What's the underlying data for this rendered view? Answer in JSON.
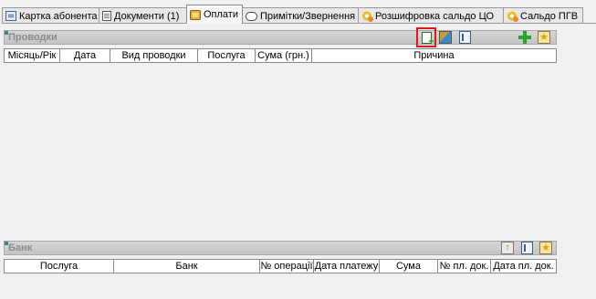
{
  "tabs": [
    {
      "label": "Картка абонента",
      "icon": "card-icon"
    },
    {
      "label": "Документи (1)",
      "icon": "document-icon"
    },
    {
      "label": "Оплати",
      "icon": "payments-icon"
    },
    {
      "label": "Примітки/Звернення",
      "icon": "note-icon"
    },
    {
      "label": "Розшифровка сальдо ЦО",
      "icon": "gear-icon"
    },
    {
      "label": "Сальдо ПГВ",
      "icon": "gear-icon"
    }
  ],
  "active_tab": "Оплати",
  "postings": {
    "title": "Проводки",
    "columns": [
      "Місяць/Рік",
      "Дата",
      "Вид проводки",
      "Послуга",
      "Сума (грн.)",
      "Причина"
    ],
    "toolbar": [
      "new-document-icon",
      "calculator-icon",
      "book-icon",
      "add-icon",
      "star-icon"
    ],
    "highlighted_tool": "new-document-icon"
  },
  "bank": {
    "title": "Банк",
    "columns": [
      "Послуга",
      "Банк",
      "№ операції",
      "Дата платежу",
      "Сума",
      "№ пл. док.",
      "Дата пл. док."
    ],
    "toolbar": [
      "upload-icon",
      "book-icon",
      "star-icon"
    ]
  }
}
